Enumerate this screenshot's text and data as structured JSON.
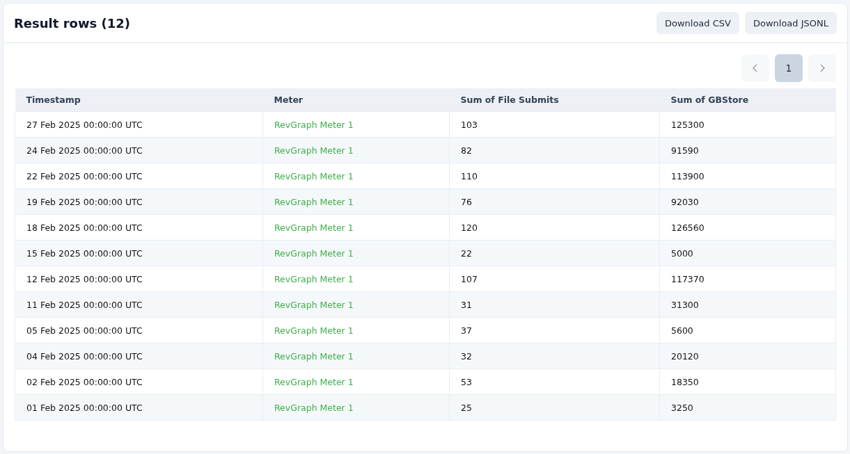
{
  "card": {
    "title": "Result rows (12)",
    "buttons": [
      "Download CSV",
      "Download JSONL"
    ]
  },
  "pagination": {
    "prev": {
      "disabled": true
    },
    "pages": [
      {
        "label": "1",
        "selected": true
      }
    ],
    "next": {
      "disabled": true
    }
  },
  "table": {
    "columns": [
      "Timestamp",
      "Meter",
      "Sum of File Submits",
      "Sum of GBStore"
    ],
    "rows": [
      [
        "27 Feb 2025 00:00:00 UTC",
        "RevGraph Meter 1",
        "103",
        "125300"
      ],
      [
        "24 Feb 2025 00:00:00 UTC",
        "RevGraph Meter 1",
        "82",
        "91590"
      ],
      [
        "22 Feb 2025 00:00:00 UTC",
        "RevGraph Meter 1",
        "110",
        "113900"
      ],
      [
        "19 Feb 2025 00:00:00 UTC",
        "RevGraph Meter 1",
        "76",
        "92030"
      ],
      [
        "18 Feb 2025 00:00:00 UTC",
        "RevGraph Meter 1",
        "120",
        "126560"
      ],
      [
        "15 Feb 2025 00:00:00 UTC",
        "RevGraph Meter 1",
        "22",
        "5000"
      ],
      [
        "12 Feb 2025 00:00:00 UTC",
        "RevGraph Meter 1",
        "107",
        "117370"
      ],
      [
        "11 Feb 2025 00:00:00 UTC",
        "RevGraph Meter 1",
        "31",
        "31300"
      ],
      [
        "05 Feb 2025 00:00:00 UTC",
        "RevGraph Meter 1",
        "37",
        "5600"
      ],
      [
        "04 Feb 2025 00:00:00 UTC",
        "RevGraph Meter 1",
        "32",
        "20120"
      ],
      [
        "02 Feb 2025 00:00:00 UTC",
        "RevGraph Meter 1",
        "53",
        "18350"
      ],
      [
        "01 Feb 2025 00:00:00 UTC",
        "RevGraph Meter 1",
        "25",
        "3250"
      ]
    ]
  }
}
